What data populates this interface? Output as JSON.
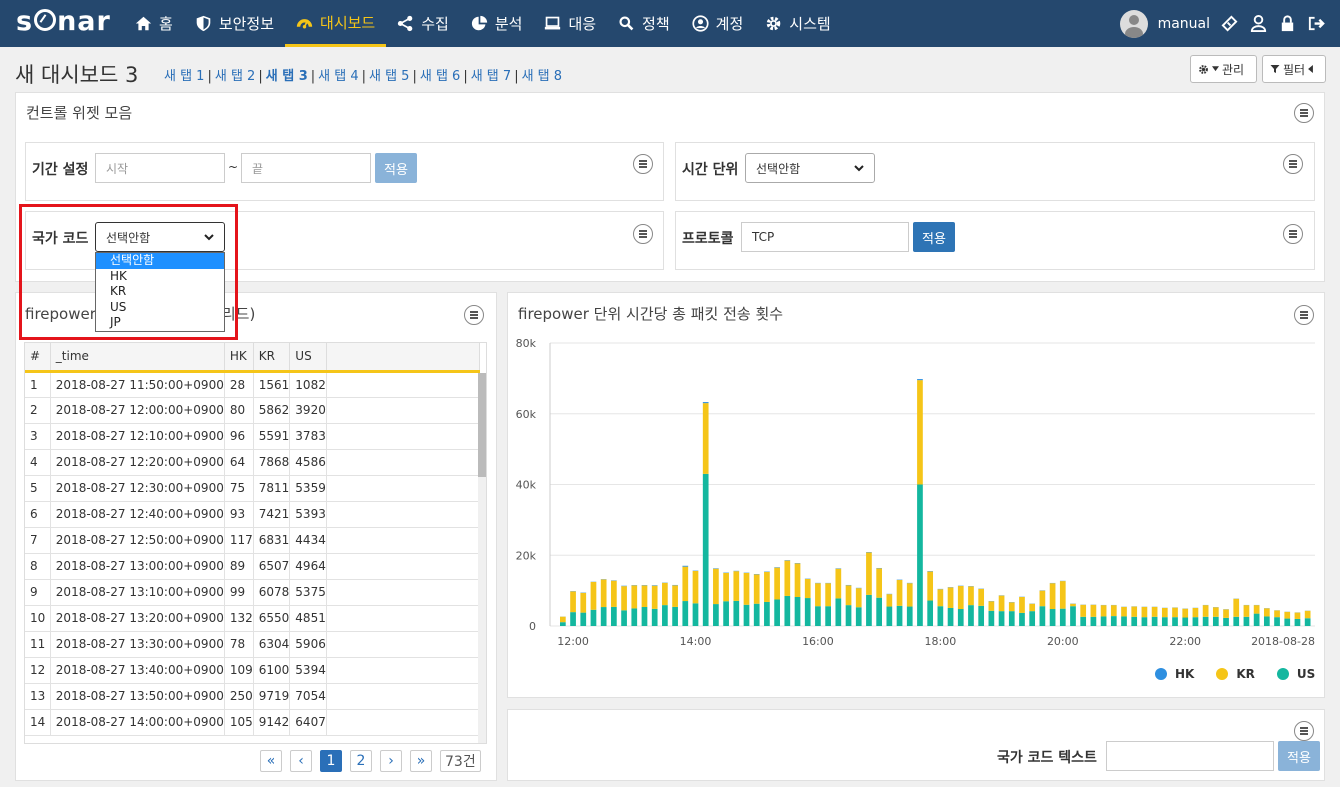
{
  "nav": {
    "logo": "sonar",
    "menu": [
      {
        "label": "홈",
        "icon": "home-icon"
      },
      {
        "label": "보안정보",
        "icon": "shield-icon"
      },
      {
        "label": "대시보드",
        "icon": "dashboard-icon",
        "active": true
      },
      {
        "label": "수집",
        "icon": "share-icon"
      },
      {
        "label": "분석",
        "icon": "pie-chart-icon"
      },
      {
        "label": "대응",
        "icon": "monitor-icon"
      },
      {
        "label": "정책",
        "icon": "search-icon"
      },
      {
        "label": "계정",
        "icon": "user-circle-icon"
      },
      {
        "label": "시스템",
        "icon": "gear-icon"
      }
    ],
    "user": "manual"
  },
  "dashboard": {
    "title": "새 대시보드 3",
    "tabs": [
      "새 탭 1",
      "새 탭 2",
      "새 탭 3",
      "새 탭 4",
      "새 탭 5",
      "새 탭 6",
      "새 탭 7",
      "새 탭 8"
    ],
    "current_tab": 2,
    "manage_label": "관리",
    "filter_label": "필터"
  },
  "controls": {
    "title": "컨트롤 위젯 모음",
    "period_label": "기간 설정",
    "start_placeholder": "시작",
    "tilde": "~",
    "end_placeholder": "끝",
    "apply": "적용",
    "time_unit_label": "시간 단위",
    "time_unit_value": "선택안함",
    "country_label": "국가 코드",
    "country_value": "선택안함",
    "country_options": [
      "선택안함",
      "HK",
      "KR",
      "US",
      "JP"
    ],
    "protocol_label": "프로토콜",
    "protocol_value": "TCP"
  },
  "grid": {
    "title_left": "firepower 단",
    "title_right": "전송 횟수 (그리드)",
    "columns": [
      "#",
      "_time",
      "HK",
      "KR",
      "US"
    ],
    "rows": [
      [
        "1",
        "2018-08-27 11:50:00+0900",
        "28",
        "1561",
        "1082"
      ],
      [
        "2",
        "2018-08-27 12:00:00+0900",
        "80",
        "5862",
        "3920"
      ],
      [
        "3",
        "2018-08-27 12:10:00+0900",
        "96",
        "5591",
        "3783"
      ],
      [
        "4",
        "2018-08-27 12:20:00+0900",
        "64",
        "7868",
        "4586"
      ],
      [
        "5",
        "2018-08-27 12:30:00+0900",
        "75",
        "7811",
        "5359"
      ],
      [
        "6",
        "2018-08-27 12:40:00+0900",
        "93",
        "7421",
        "5393"
      ],
      [
        "7",
        "2018-08-27 12:50:00+0900",
        "117",
        "6831",
        "4434"
      ],
      [
        "8",
        "2018-08-27 13:00:00+0900",
        "89",
        "6507",
        "4964"
      ],
      [
        "9",
        "2018-08-27 13:10:00+0900",
        "99",
        "6078",
        "5375"
      ],
      [
        "10",
        "2018-08-27 13:20:00+0900",
        "132",
        "6550",
        "4851"
      ],
      [
        "11",
        "2018-08-27 13:30:00+0900",
        "78",
        "6304",
        "5906"
      ],
      [
        "12",
        "2018-08-27 13:40:00+0900",
        "109",
        "6100",
        "5394"
      ],
      [
        "13",
        "2018-08-27 13:50:00+0900",
        "250",
        "9719",
        "7054"
      ],
      [
        "14",
        "2018-08-27 14:00:00+0900",
        "105",
        "9142",
        "6407"
      ]
    ],
    "pager": [
      "«",
      "‹",
      "1",
      "2",
      "›",
      "»"
    ],
    "current_page": "1",
    "total": "73건"
  },
  "chart_widget": {
    "title": "firepower 단위 시간당 총 패킷 전송 횟수"
  },
  "text_widget": {
    "label": "국가 코드 텍스트",
    "apply": "적용"
  },
  "chart_data": {
    "type": "bar",
    "stacked": true,
    "title": "firepower 단위 시간당 총 패킷 전송 횟수",
    "ylim": [
      0,
      80000
    ],
    "yticks": [
      "0",
      "20k",
      "40k",
      "60k",
      "80k"
    ],
    "xticks": [
      {
        "label": "12:00",
        "index": 1
      },
      {
        "label": "14:00",
        "index": 13
      },
      {
        "label": "16:00",
        "index": 25
      },
      {
        "label": "18:00",
        "index": 37
      },
      {
        "label": "20:00",
        "index": 49
      },
      {
        "label": "22:00",
        "index": 61
      },
      {
        "label": "2018-08-28",
        "index": 73
      }
    ],
    "grid": true,
    "legend_position": "bottom-right",
    "colors": {
      "HK": "#2e8fe0",
      "KR": "#f5c518",
      "US": "#14b79f"
    },
    "series": [
      {
        "name": "US",
        "values": [
          1082,
          3920,
          3783,
          4586,
          5359,
          5393,
          4434,
          4964,
          5375,
          4851,
          5906,
          5394,
          7054,
          6407,
          43000,
          6200,
          7000,
          7100,
          6000,
          6300,
          6800,
          7500,
          8500,
          8200,
          7900,
          5600,
          5600,
          7800,
          5900,
          5300,
          8800,
          8000,
          5500,
          5700,
          5500,
          40000,
          7200,
          5600,
          5100,
          4800,
          5900,
          5700,
          4300,
          4200,
          4200,
          3700,
          4200,
          5600,
          4800,
          4900,
          5600,
          2600,
          2600,
          2700,
          2800,
          2700,
          2600,
          2500,
          2600,
          2500,
          2500,
          2400,
          2500,
          2600,
          2600,
          2300,
          2600,
          2600,
          3500,
          2700,
          2500,
          2100,
          2000,
          2200
        ]
      },
      {
        "name": "KR",
        "values": [
          1561,
          5862,
          5591,
          7868,
          7811,
          7421,
          6831,
          6507,
          6078,
          6550,
          6304,
          6100,
          9719,
          9142,
          20000,
          10000,
          8000,
          8400,
          9000,
          8300,
          8500,
          9000,
          10000,
          9500,
          5400,
          6500,
          6500,
          8400,
          5600,
          5400,
          12000,
          8300,
          3500,
          7300,
          6600,
          29500,
          8200,
          4800,
          5800,
          6500,
          5300,
          4800,
          2700,
          4400,
          2500,
          4500,
          2100,
          4400,
          7300,
          7800,
          700,
          3400,
          3400,
          3200,
          3100,
          2700,
          2900,
          2900,
          2800,
          2600,
          2700,
          2500,
          2600,
          3300,
          2700,
          2400,
          5100,
          3300,
          2400,
          2300,
          1900,
          1900,
          1800,
          2100
        ]
      },
      {
        "name": "HK",
        "values": [
          28,
          80,
          96,
          64,
          75,
          93,
          117,
          89,
          99,
          132,
          78,
          109,
          250,
          105,
          300,
          120,
          110,
          100,
          90,
          100,
          110,
          120,
          110,
          100,
          90,
          90,
          80,
          110,
          100,
          90,
          110,
          100,
          90,
          100,
          90,
          300,
          110,
          90,
          80,
          90,
          80,
          80,
          70,
          70,
          70,
          70,
          60,
          80,
          70,
          70,
          60,
          50,
          50,
          50,
          50,
          50,
          50,
          50,
          50,
          50,
          50,
          50,
          50,
          50,
          50,
          50,
          50,
          50,
          50,
          50,
          40,
          40,
          40,
          40
        ]
      }
    ]
  }
}
